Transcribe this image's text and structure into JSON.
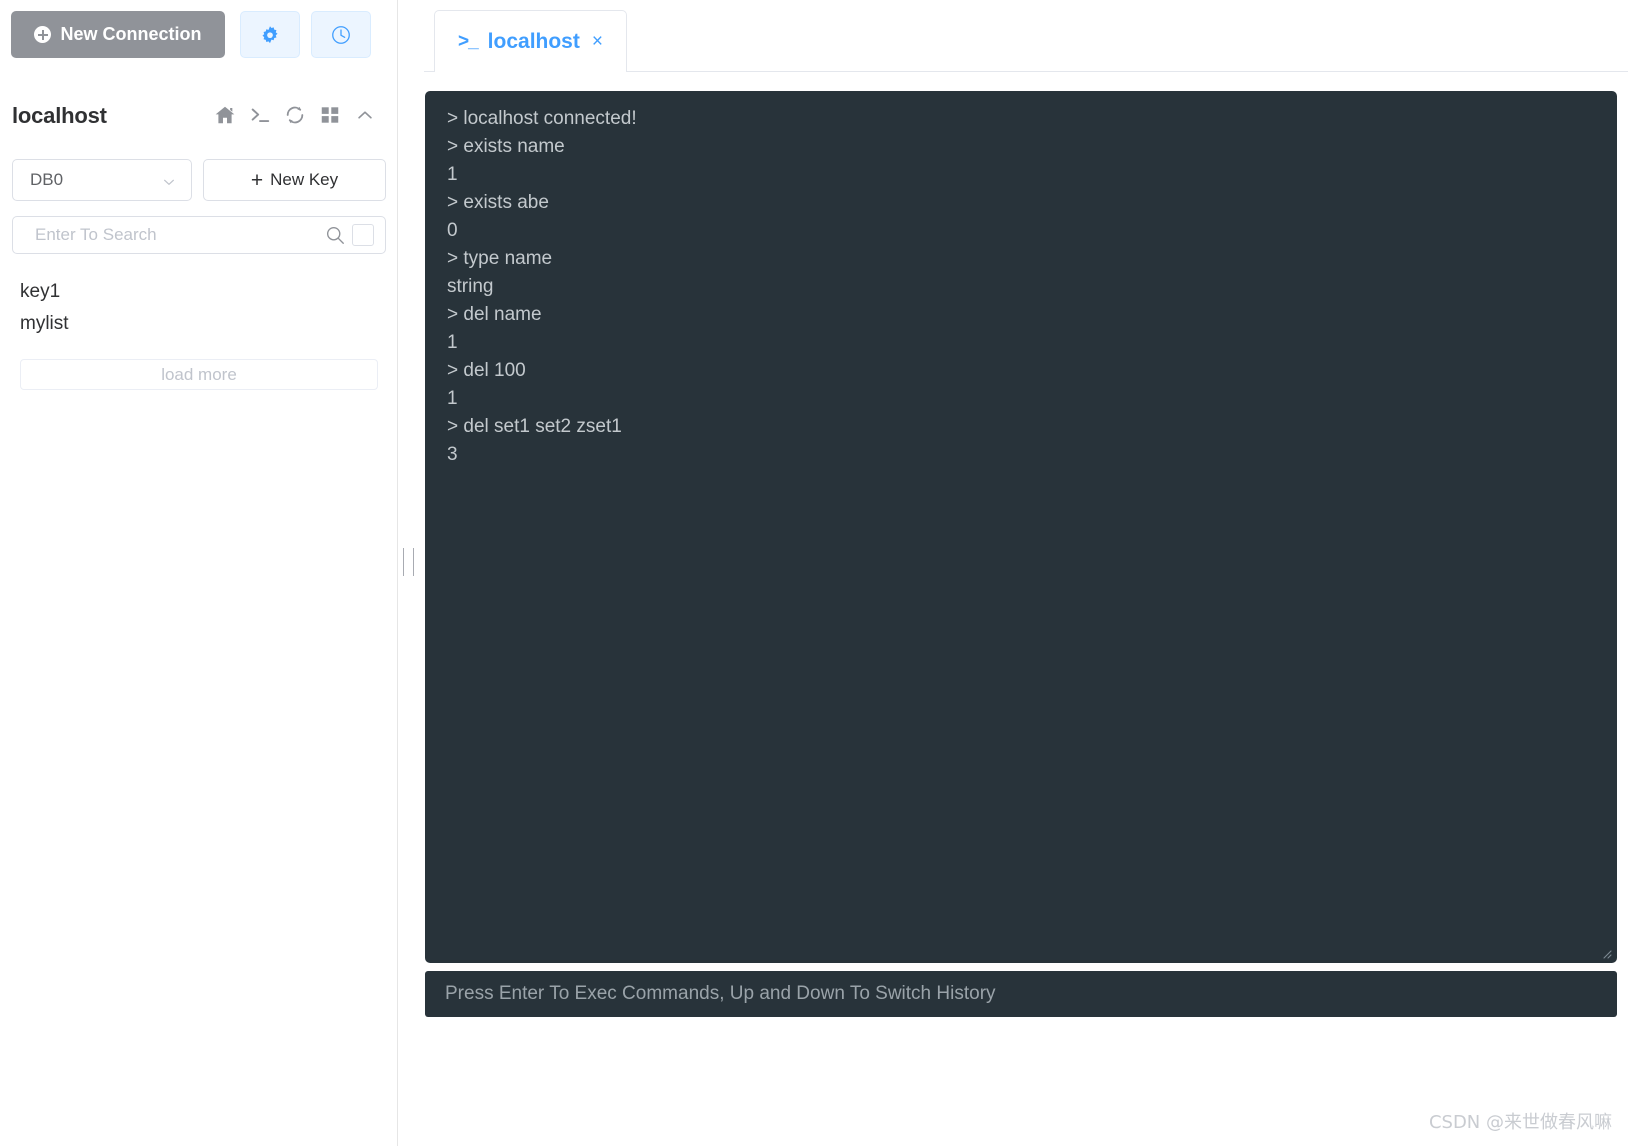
{
  "toolbar": {
    "new_connection_label": "New Connection",
    "settings_icon": "gear-icon",
    "history_icon": "clock-icon"
  },
  "sidebar": {
    "connection_title": "localhost",
    "header_icons": [
      "home-icon",
      "terminal-icon",
      "refresh-icon",
      "grid-icon",
      "chevron-up-icon"
    ],
    "db_select_value": "DB0",
    "new_key_label": "New Key",
    "new_key_plus": "+",
    "search_placeholder": "Enter To Search",
    "search_value": "",
    "keys": [
      {
        "name": "key1"
      },
      {
        "name": "mylist"
      }
    ],
    "load_more_label": "load more"
  },
  "tabs": [
    {
      "prompt_icon": ">_",
      "label": "localhost",
      "close_icon": "×",
      "active": true
    }
  ],
  "terminal": {
    "lines": [
      "> localhost connected!",
      "> exists name",
      "1",
      "> exists abe",
      "0",
      "> type name",
      "string",
      "> del name",
      "1",
      "> del 100",
      "1",
      "> del set1 set2 zset1",
      "3"
    ],
    "input_value": "",
    "input_placeholder": "Press Enter To Exec Commands, Up and Down To Switch History",
    "background_color": "#28333a",
    "text_color": "#c3c9cd"
  },
  "watermark": {
    "text": "CSDN @来世做春风嘛"
  },
  "colors": {
    "accent": "#409eff",
    "accent_bg": "#ecf5ff",
    "button_gray": "#909399",
    "terminal_bg": "#28333a"
  }
}
